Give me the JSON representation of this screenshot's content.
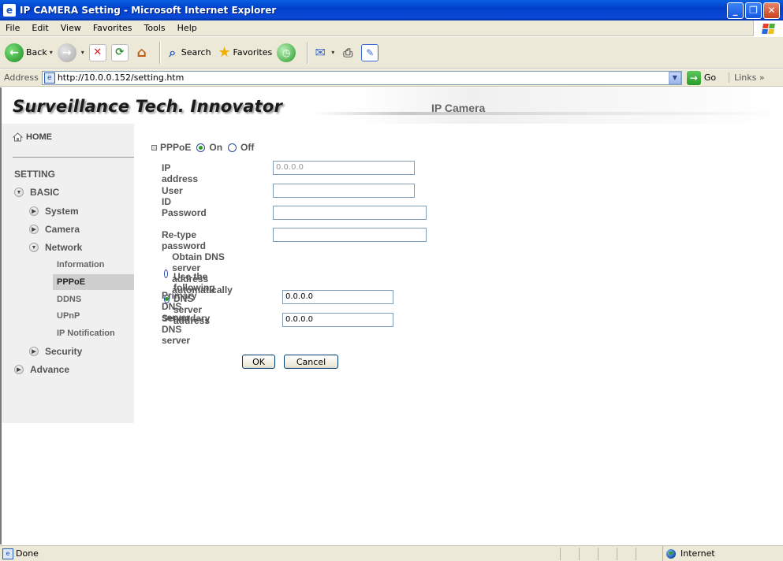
{
  "window": {
    "title": "IP CAMERA Setting - Microsoft Internet Explorer"
  },
  "menu": [
    "File",
    "Edit",
    "View",
    "Favorites",
    "Tools",
    "Help"
  ],
  "toolbar": {
    "back": "Back",
    "search": "Search",
    "favorites": "Favorites"
  },
  "address": {
    "label": "Address",
    "url": "http://10.0.0.152/setting.htm",
    "go": "Go",
    "links": "Links"
  },
  "banner": {
    "brand": "Surveillance Tech. Innovator",
    "product": "IP Camera"
  },
  "sidebar": {
    "home": "HOME",
    "setting": "SETTING",
    "basic": "BASIC",
    "system": "System",
    "camera": "Camera",
    "network": "Network",
    "network_items": [
      "Information",
      "PPPoE",
      "DDNS",
      "UPnP",
      "IP Notification"
    ],
    "security": "Security",
    "advance": "Advance"
  },
  "form": {
    "pppoe_label": "PPPoE",
    "on_label": "On",
    "off_label": "Off",
    "pppoe_state": "On",
    "ip_address_label": "IP address",
    "ip_address_value": "0.0.0.0",
    "user_id_label": "User ID",
    "user_id_value": "",
    "password_label": "Password",
    "password_value": "",
    "retype_label": "Re-type password",
    "retype_value": "",
    "dns_auto_label": "Obtain DNS server address automatically",
    "dns_manual_label": "Use the following DNS server address",
    "dns_mode": "manual",
    "primary_dns_label": "Primary DNS server",
    "primary_dns_value": "0.0.0.0",
    "secondary_dns_label": "Sencodary DNS server",
    "secondary_dns_value": "0.0.0.0",
    "ok_label": "OK",
    "cancel_label": "Cancel"
  },
  "status": {
    "text": "Done",
    "zone": "Internet"
  },
  "colors": {
    "titlebar": "#0a4ad8",
    "chrome": "#ece9d8",
    "sidebar_bg": "#f0f0f0",
    "active_item_bg": "#cfcfcf"
  }
}
